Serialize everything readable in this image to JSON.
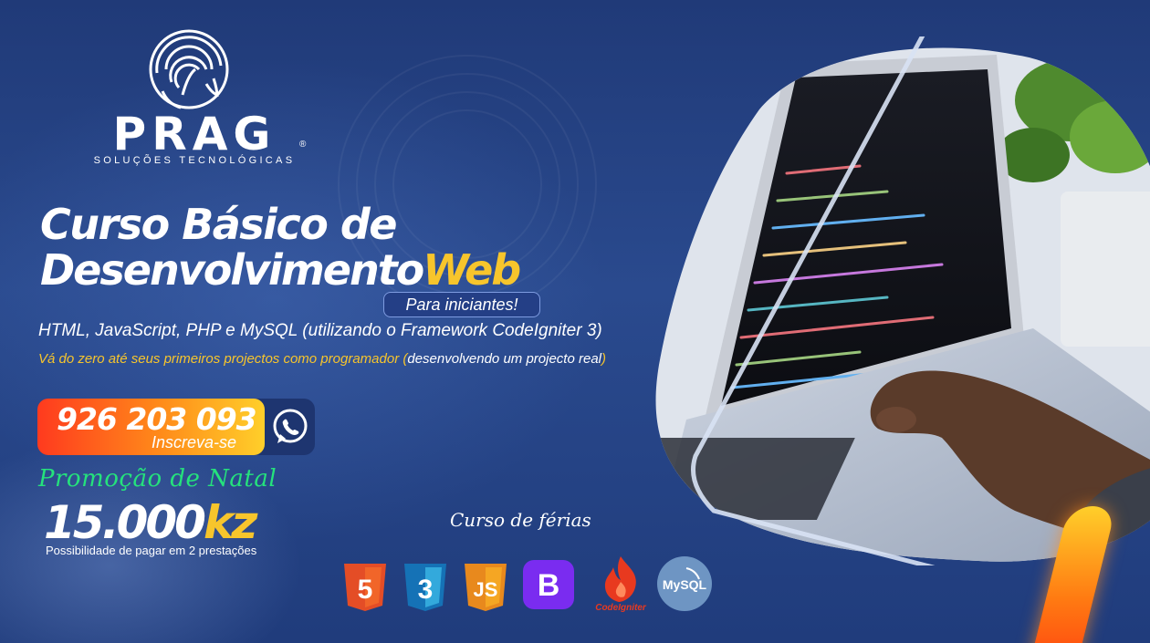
{
  "brand": {
    "name": "PRAG",
    "registered": "®",
    "tagline": "SOLUÇÕES TECNOLÓGICAS"
  },
  "course": {
    "title_line1": "Curso Básico de",
    "title_line2_main": "Desenvolvimento",
    "title_line2_accent": "Web",
    "audience": "Para iniciantes!",
    "technologies": "HTML, JavaScript, PHP e MySQL (utilizando o Framework CodeIgniter 3)",
    "promise": "Vá do zero até seus primeiros projectos como programador (",
    "promise_note": "desenvolvendo um projecto real",
    "promise_close": ")"
  },
  "contact": {
    "phone": "926 203 093",
    "cta": "Inscreva-se",
    "channel_icon": "whatsapp-icon"
  },
  "offer": {
    "promo": "Promoção de Natal",
    "price_number": "15.000",
    "price_currency": "kz",
    "installments": "Possibilidade de pagar em 2 prestações"
  },
  "schedule": {
    "label": "Curso de férias"
  },
  "tech_logos": {
    "html5": "5",
    "css3": "3",
    "js": "JS",
    "bootstrap": "B",
    "codeigniter": "CodeIgniter",
    "mysql": "MySQL"
  },
  "colors": {
    "accent_yellow": "#f7c52c",
    "promo_green": "#25e27c",
    "background_blue": "#2a4a8e",
    "phone_gradient_start": "#ff3a1e",
    "phone_gradient_end": "#ffcf2a"
  }
}
